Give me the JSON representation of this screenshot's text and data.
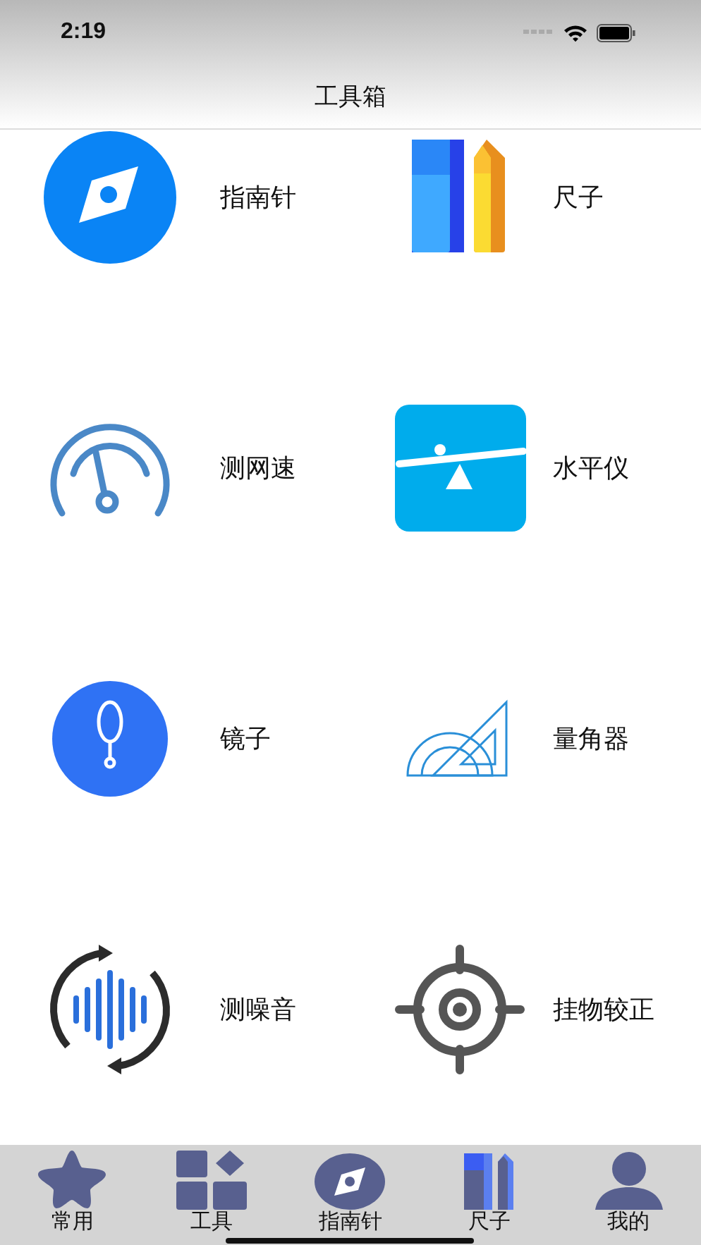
{
  "status_bar": {
    "time": "2:19"
  },
  "nav": {
    "title": "工具箱"
  },
  "tools": [
    {
      "kind": "compass",
      "label": "指南针"
    },
    {
      "kind": "ruler",
      "label": "尺子"
    },
    {
      "kind": "speed",
      "label": "测网速"
    },
    {
      "kind": "level",
      "label": "水平仪"
    },
    {
      "kind": "mirror",
      "label": "镜子"
    },
    {
      "kind": "protractor",
      "label": "量角器"
    },
    {
      "kind": "noise",
      "label": "测噪音"
    },
    {
      "kind": "target",
      "label": "挂物较正"
    }
  ],
  "tab_bar": [
    {
      "kind": "star",
      "label": "常用"
    },
    {
      "kind": "grid",
      "label": "工具"
    },
    {
      "kind": "compass",
      "label": "指南针"
    },
    {
      "kind": "ruler",
      "label": "尺子"
    },
    {
      "kind": "person",
      "label": "我的"
    }
  ]
}
